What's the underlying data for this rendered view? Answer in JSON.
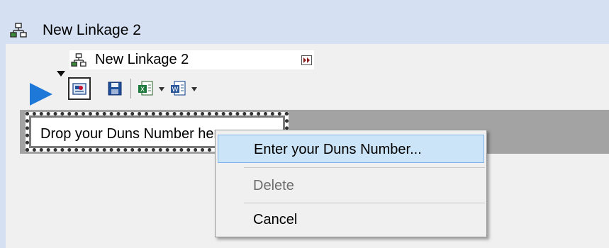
{
  "window": {
    "title": "New Linkage 2"
  },
  "linkage": {
    "name": "New Linkage 2"
  },
  "drop_zone": {
    "text": "Drop your Duns Number here..."
  },
  "context_menu": {
    "items": [
      {
        "label": "Enter your Duns Number...",
        "state": "highlighted"
      },
      {
        "label": "Delete",
        "state": "disabled"
      },
      {
        "label": "Cancel",
        "state": "enabled"
      }
    ]
  },
  "colors": {
    "title_bar": "#d5e1f2",
    "play_accent": "#1e78d7",
    "band_gray": "#a3a3a3",
    "menu_highlight": "#cce4f7"
  },
  "icons": {
    "title": "linkage-tree-icon",
    "play": "play-icon",
    "expand": "expand-double-arrow-icon",
    "toolbar": [
      "search-attribute-icon",
      "save-disk-icon",
      "export-excel-icon",
      "export-word-icon"
    ]
  }
}
